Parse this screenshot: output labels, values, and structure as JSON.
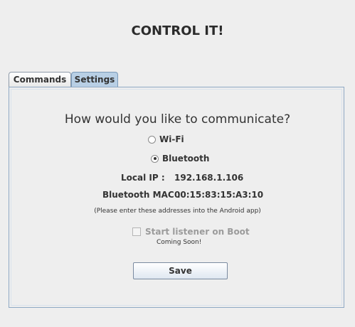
{
  "app": {
    "title": "CONTROL IT!"
  },
  "tabs": [
    {
      "label": "Commands",
      "selected": false
    },
    {
      "label": "Settings",
      "selected": true
    }
  ],
  "settings": {
    "question": "How would you like to communicate?",
    "options": [
      {
        "label": "Wi-Fi",
        "selected": false
      },
      {
        "label": "Bluetooth",
        "selected": true
      }
    ],
    "local_ip_label": "Local IP :",
    "local_ip_value": "192.168.1.106",
    "bt_mac_label": "Bluetooth MAC :",
    "bt_mac_value": "00:15:83:15:A3:10",
    "hint": "(Please enter these addresses into the Android app)",
    "start_on_boot_label": "Start listener on Boot",
    "start_on_boot_enabled": false,
    "coming_soon": "Coming Soon!",
    "save_label": "Save"
  }
}
